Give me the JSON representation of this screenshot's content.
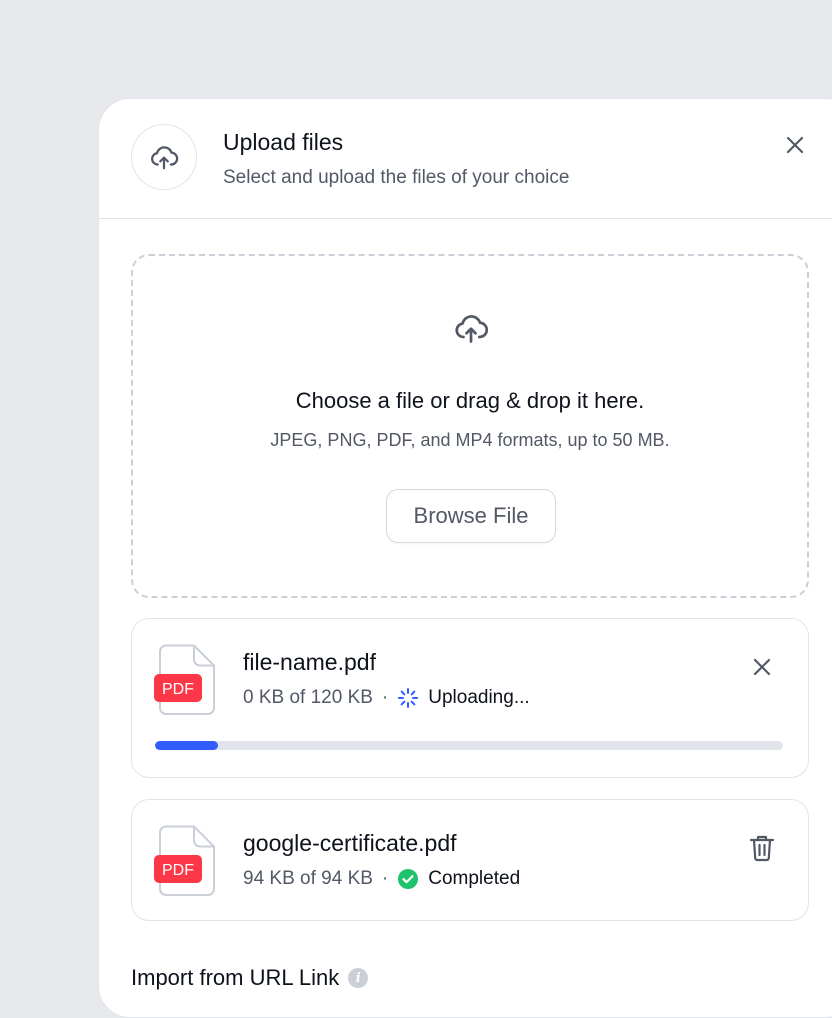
{
  "modal": {
    "title": "Upload files",
    "subtitle": "Select and upload the files of your choice",
    "header_icon": "cloud-upload-icon",
    "close_icon": "close-icon"
  },
  "dropzone": {
    "icon": "cloud-upload-icon",
    "title": "Choose a file or drag & drop it here.",
    "subtitle": "JPEG, PNG, PDF, and MP4 formats, up to 50 MB.",
    "browse_label": "Browse File"
  },
  "files": [
    {
      "name": "file-name.pdf",
      "badge": "PDF",
      "size_text": "0 KB of 120 KB",
      "separator": "·",
      "status": "Uploading...",
      "status_icon": "spinner-icon",
      "action_icon": "close-icon",
      "progress": 0.1
    },
    {
      "name": "google-certificate.pdf",
      "badge": "PDF",
      "size_text": "94 KB of 94 KB",
      "separator": "·",
      "status": "Completed",
      "status_icon": "check-circle-icon",
      "action_icon": "trash-icon"
    }
  ],
  "import": {
    "label": "Import from URL Link",
    "info_glyph": "i"
  },
  "colors": {
    "accent": "#335cff",
    "success": "#1fc16b",
    "pdf_badge": "#fb3748",
    "text_primary": "#0e121b",
    "text_secondary": "#525866",
    "border": "#e1e4ea"
  }
}
